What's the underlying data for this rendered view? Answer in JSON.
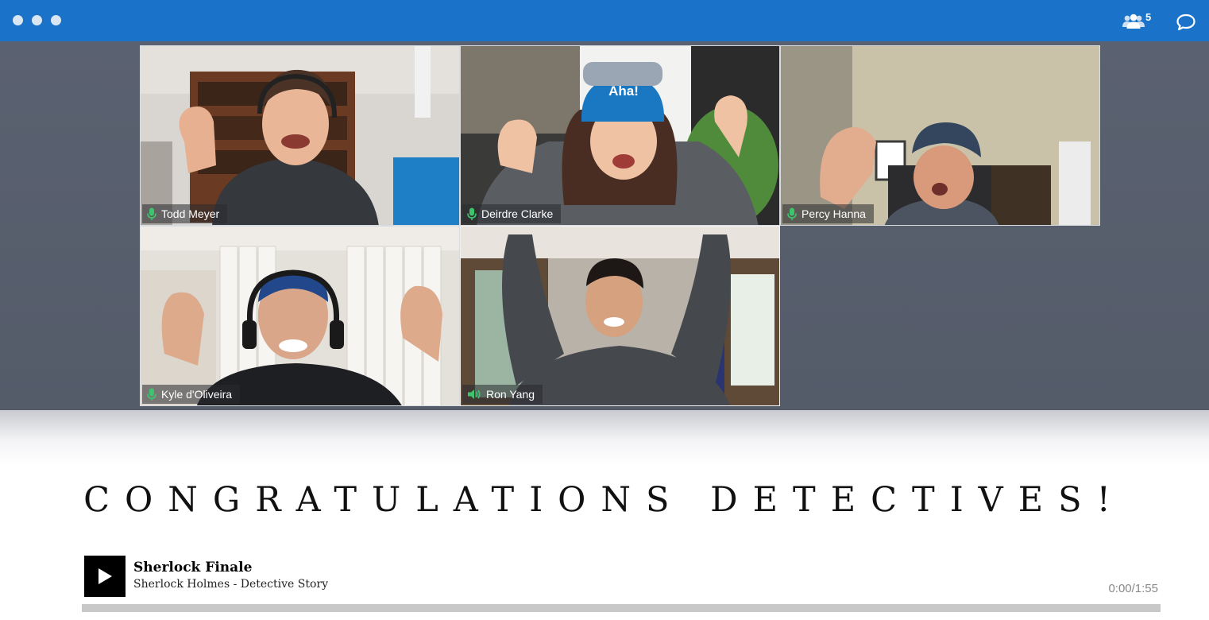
{
  "topbar": {
    "participants_count": "5",
    "icons": [
      "window-dots",
      "participants-icon",
      "chat-icon"
    ],
    "accent_color": "#1a73c9"
  },
  "participants": [
    {
      "name": "Todd Meyer",
      "audio": "mic"
    },
    {
      "name": "Deirdre Clarke",
      "audio": "mic"
    },
    {
      "name": "Percy Hanna",
      "audio": "mic"
    },
    {
      "name": "Kyle d'Oliveira",
      "audio": "mic"
    },
    {
      "name": "Ron Yang",
      "audio": "speaking"
    }
  ],
  "headline": "CONGRATULATIONS DETECTIVES!",
  "player": {
    "title": "Sherlock Finale",
    "artist": "Sherlock Holmes - Detective Story",
    "time": "0:00/1:55",
    "progress": 0
  },
  "colors": {
    "indicator_green": "#3ec46d",
    "stage": "#555c6a"
  }
}
